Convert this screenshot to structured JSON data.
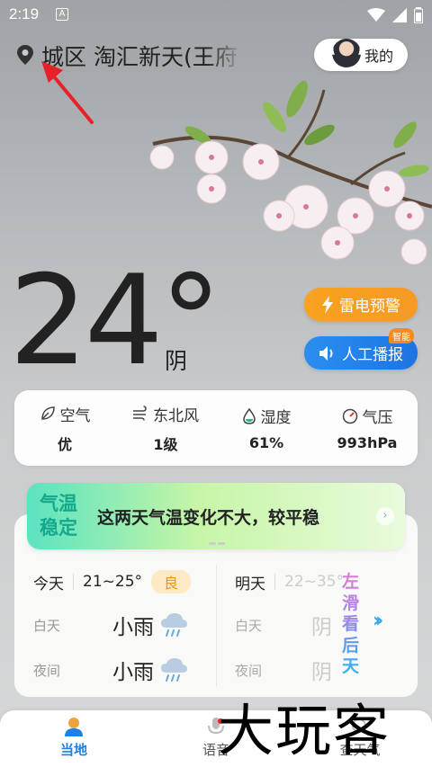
{
  "status_bar": {
    "time": "2:19",
    "notif_letter": "A"
  },
  "header": {
    "location": "城区 淘汇新天(王府",
    "mine_label": "我的"
  },
  "current": {
    "temperature": "24°",
    "condition": "阴"
  },
  "alerts": {
    "thunder_label": "雷电预警",
    "ai_label": "人工播报",
    "ai_badge": "智能"
  },
  "metrics": [
    {
      "label": "空气",
      "value": "优",
      "icon": "leaf-icon"
    },
    {
      "label": "东北风",
      "value": "1级",
      "icon": "wind-icon"
    },
    {
      "label": "湿度",
      "value": "61%",
      "icon": "humidity-drop-icon"
    },
    {
      "label": "气压",
      "value": "993hPa",
      "icon": "pressure-gauge-icon"
    }
  ],
  "tip": {
    "tag": "气温稳定",
    "text": "这两天气温变化不大，较平稳"
  },
  "forecast": {
    "today": {
      "label": "今天",
      "range": "21~25°",
      "aqi": "良",
      "day_label": "白天",
      "day_weather": "小雨",
      "night_label": "夜间",
      "night_weather": "小雨"
    },
    "tomorrow": {
      "label": "明天",
      "range": "22~35°",
      "day_label": "白天",
      "day_weather": "阴",
      "night_label": "夜间",
      "night_weather": "阴"
    },
    "swipe_hint": "左滑看后天",
    "swipe_arrow": "››"
  },
  "bottom_nav": [
    {
      "label": "当地",
      "active": true
    },
    {
      "label": "语音",
      "active": false
    },
    {
      "label": "查天气",
      "active": false
    }
  ],
  "watermark": "大玩客",
  "colors": {
    "accent_blue": "#1f7fe6",
    "thunder_orange": "#f8a21f",
    "aqi_good": "#e59a1c",
    "tip_green": "#14a98c"
  }
}
